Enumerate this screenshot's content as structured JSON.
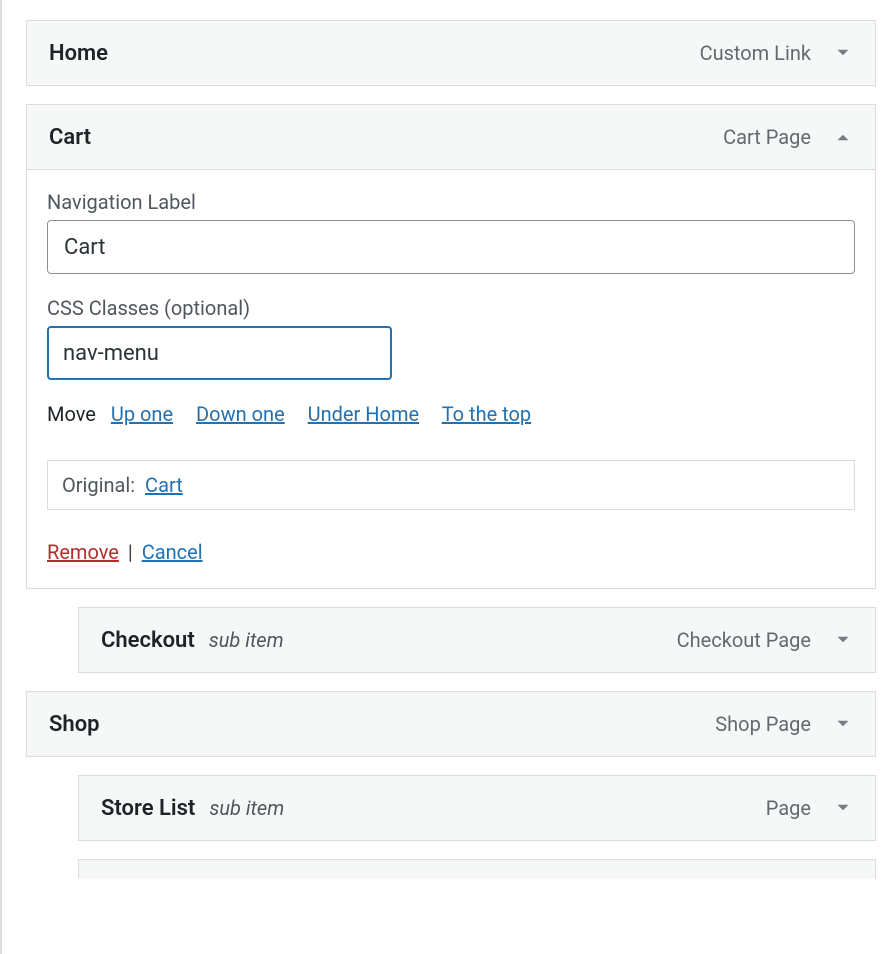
{
  "items": {
    "home": {
      "title": "Home",
      "type": "Custom Link"
    },
    "cart": {
      "title": "Cart",
      "type": "Cart Page"
    },
    "checkout": {
      "title": "Checkout",
      "sub": "sub item",
      "type": "Checkout Page"
    },
    "shop": {
      "title": "Shop",
      "type": "Shop Page"
    },
    "storelist": {
      "title": "Store List",
      "sub": "sub item",
      "type": "Page"
    }
  },
  "cart_panel": {
    "nav_label_label": "Navigation Label",
    "nav_label_value": "Cart",
    "css_label": "CSS Classes (optional)",
    "css_value": "nav-menu",
    "move_label": "Move",
    "move_up": "Up one",
    "move_down": "Down one",
    "move_under": "Under Home",
    "move_top": "To the top",
    "original_label": "Original:",
    "original_link": "Cart",
    "remove": "Remove",
    "cancel": "Cancel"
  }
}
